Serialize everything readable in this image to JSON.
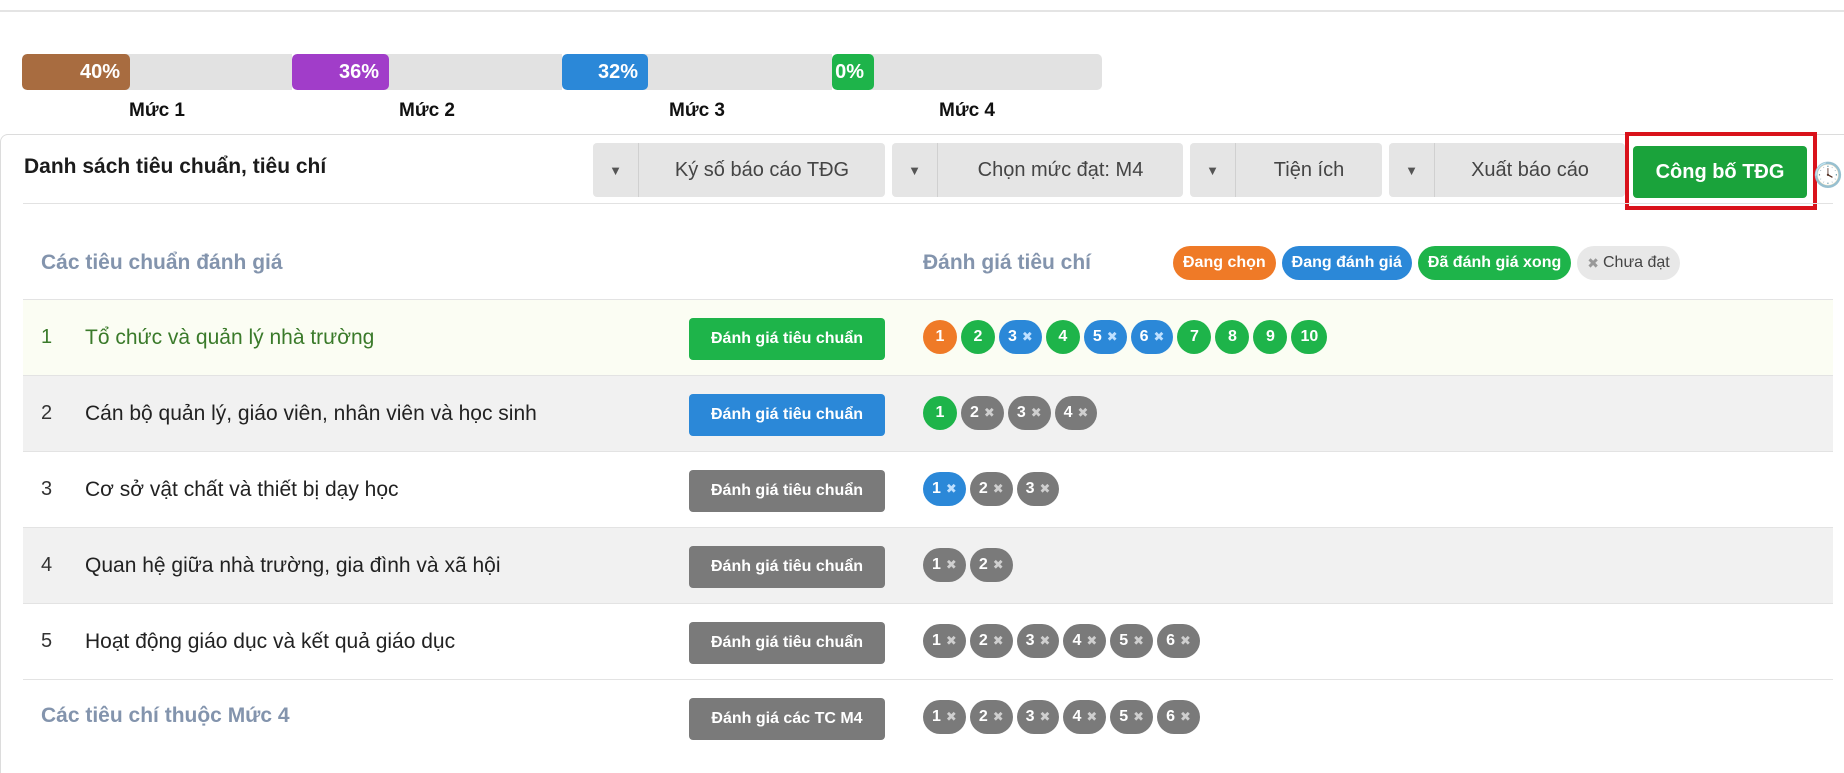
{
  "levels": [
    {
      "label": "Mức 1",
      "percent_text": "40%",
      "percent": 40,
      "color": "#a86c40"
    },
    {
      "label": "Mức 2",
      "percent_text": "36%",
      "percent": 36,
      "color": "#a13dc9"
    },
    {
      "label": "Mức 3",
      "percent_text": "32%",
      "percent": 32,
      "color": "#2b88d8"
    },
    {
      "label": "Mức 4",
      "percent_text": "0%",
      "percent": 0,
      "color": "#1eb44a"
    }
  ],
  "panel": {
    "title": "Danh sách tiêu chuẩn, tiêu chí",
    "toolbar": {
      "sign_report": "Ký số báo cáo TĐG",
      "choose_level": "Chọn mức đạt: M4",
      "utilities": "Tiện ích",
      "export_report": "Xuất báo cáo",
      "publish": "Công bố TĐG"
    }
  },
  "table": {
    "header_left": "Các tiêu chuẩn đánh giá",
    "header_right": "Đánh giá tiêu chí",
    "legend": {
      "selecting": "Đang chọn",
      "evaluating": "Đang đánh giá",
      "evaluated": "Đã đánh giá xong",
      "not_met": "Chưa đạt"
    },
    "rows": [
      {
        "num": "1",
        "name": "Tổ chức và quản lý nhà trường",
        "button": "Đánh giá tiêu chuẩn"
      },
      {
        "num": "2",
        "name": "Cán bộ quản lý, giáo viên, nhân viên và học sinh",
        "button": "Đánh giá tiêu chuẩn"
      },
      {
        "num": "3",
        "name": "Cơ sở vật chất và thiết bị dạy học",
        "button": "Đánh giá tiêu chuẩn"
      },
      {
        "num": "4",
        "name": "Quan hệ giữa nhà trường, gia đình và xã hội",
        "button": "Đánh giá tiêu chuẩn"
      },
      {
        "num": "5",
        "name": "Hoạt động giáo dục và kết quả giáo dục",
        "button": "Đánh giá tiêu chuẩn"
      }
    ],
    "m4_row": {
      "label": "Các tiêu chí thuộc Mức 4",
      "button": "Đánh giá các TC M4"
    },
    "criteria": {
      "row1": [
        "1",
        "2",
        "3",
        "4",
        "5",
        "6",
        "7",
        "8",
        "9",
        "10"
      ],
      "row2": [
        "1",
        "2",
        "3",
        "4"
      ],
      "row3": [
        "1",
        "2",
        "3"
      ],
      "row4": [
        "1",
        "2"
      ],
      "row5": [
        "1",
        "2",
        "3",
        "4",
        "5",
        "6"
      ],
      "m4": [
        "1",
        "2",
        "3",
        "4",
        "5",
        "6"
      ]
    }
  }
}
